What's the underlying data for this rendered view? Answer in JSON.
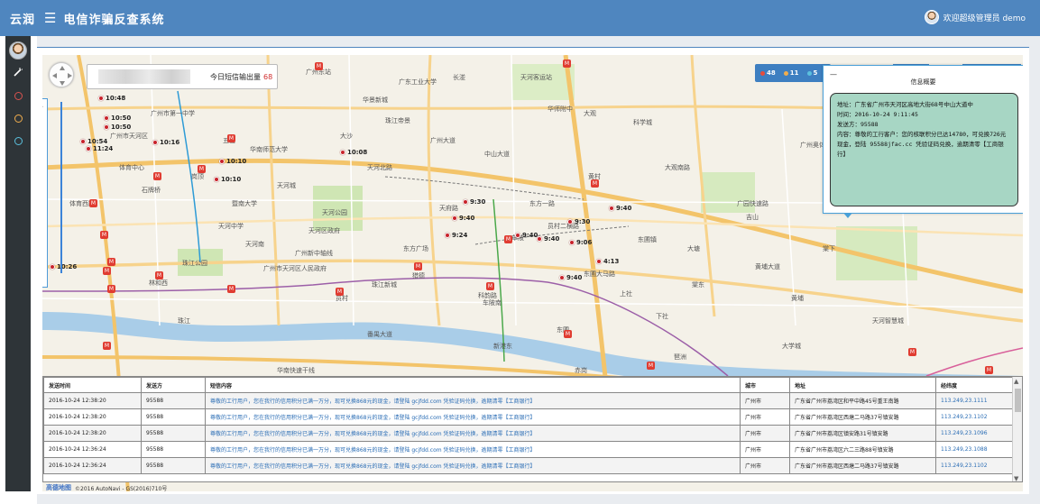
{
  "header": {
    "brand": "云润",
    "menu_icon": "☰",
    "title": "电信诈骗反查系统",
    "welcome": "欢迎超级管理员 demo"
  },
  "sidenav": {
    "items": [
      {
        "name": "wand-icon",
        "glyph": "✎",
        "color": "#ffffff"
      },
      {
        "name": "red-circle-icon",
        "color": "#d9534f"
      },
      {
        "name": "orange-circle-icon",
        "color": "#f0ad4e"
      },
      {
        "name": "blue-circle-icon",
        "color": "#5bc0de"
      }
    ]
  },
  "count_box": {
    "label": "今日短信输出量",
    "value": "68"
  },
  "stats": {
    "red": "48",
    "orange": "11",
    "blue": "5"
  },
  "popup": {
    "close": "—",
    "title": "信息概要",
    "address": "地址：广东省广州市天河区高地大街68号中山大道中",
    "time": "时间：2016-10-24 9:11:45",
    "sender": "发送方：95588",
    "content": "内容：尊敬的工行客户：您的核联积分已达14780，可兑换726元现金，登陆 95588jfac.cc 凭验证码兑换，逾期清零【工商银行】"
  },
  "map_labels": [
    "广州东站",
    "广州市天河区",
    "天河公园",
    "天河客运站",
    "黄埔区",
    "珠江公园",
    "暨南大学",
    "华南师范大学",
    "体育中心",
    "石牌桥",
    "岗顶",
    "华景新城",
    "五山",
    "车陂",
    "东圃",
    "珠江新城",
    "猎德",
    "员村",
    "科韵路",
    "大观南路",
    "天河南",
    "林和西",
    "体育西路",
    "黄村",
    "棠下",
    "龙洞",
    "东圃大马路",
    "车陂南",
    "员村二横路",
    "广州大道",
    "中山大道",
    "广园快速路",
    "华南快速干线",
    "天河北路",
    "天府路",
    "黄埔大道",
    "珠江",
    "广州新中轴线",
    "琶洲",
    "赤岗",
    "新港东",
    "大塘",
    "天河智慧城",
    "东方一路",
    "珠江帝景",
    "大学城",
    "番禺大道",
    "科学城",
    "萝岗",
    "广州市第一中学",
    "上社",
    "下社",
    "天河区政府",
    "华师附中",
    "广东工业大学",
    "广州奥体中心",
    "东方广场",
    "棠东",
    "广州市天河区人民政府",
    "大观",
    "吉山",
    "黄埔",
    "长湴",
    "大沙",
    "夏园",
    "天河城",
    "天河中学",
    "东圃镇"
  ],
  "markers": [
    {
      "label": "10:48",
      "name": "marker-1048"
    },
    {
      "label": "10:50",
      "name": "marker-1050-a"
    },
    {
      "label": "10:50",
      "name": "marker-1050-b"
    },
    {
      "label": "10:54",
      "name": "marker-1054"
    },
    {
      "label": "11:24",
      "name": "marker-1124"
    },
    {
      "label": "10:16",
      "name": "marker-1016"
    },
    {
      "label": "10:08",
      "name": "marker-1008"
    },
    {
      "label": "10:10",
      "name": "marker-1010-a"
    },
    {
      "label": "10:10",
      "name": "marker-1010-b"
    },
    {
      "label": "10:26",
      "name": "marker-1026"
    },
    {
      "label": "9:30",
      "name": "marker-930-a"
    },
    {
      "label": "9:40",
      "name": "marker-940-a"
    },
    {
      "label": "9:24",
      "name": "marker-924"
    },
    {
      "label": "9:40",
      "name": "marker-940-b"
    },
    {
      "label": "9:30",
      "name": "marker-930-b"
    },
    {
      "label": "9:06",
      "name": "marker-906"
    },
    {
      "label": "9:40",
      "name": "marker-940-c"
    },
    {
      "label": "9:40",
      "name": "marker-940-d"
    },
    {
      "label": "4:13",
      "name": "marker-413"
    },
    {
      "label": "9:40",
      "name": "marker-940-e"
    }
  ],
  "table": {
    "headers": [
      "发送时间",
      "发送方",
      "短信内容",
      "城市",
      "地址",
      "经纬度"
    ],
    "rows": [
      [
        "2016-10-24 12:38:20",
        "95588",
        "尊敬的工行用户，您在我行的信用积分已满一万分，现可兑换868元的现金，请登陆 gcjfdd.com 凭验证码兑换，逾期清零【工商银行】",
        "广州市",
        "广东省广州市荔湾区和平中路45号重王南路",
        "113.249,23.1111"
      ],
      [
        "2016-10-24 12:38:20",
        "95588",
        "尊敬的工行用户，您在我行的信用积分已满一万分，现可兑换868元的现金，请登陆 gcjfdd.com 凭验证码兑换，逾期清零【工商银行】",
        "广州市",
        "广东省广州市荔湾区西塘二马路37号镇安路",
        "113.249,23.1102"
      ],
      [
        "2016-10-24 12:38:20",
        "95588",
        "尊敬的工行用户，您在我行的信用积分已满一万分，现可兑换868元的现金，请登陆 gcjfdd.com 凭验证码兑换，逾期清零【工商银行】",
        "广州市",
        "广东省广州市荔湾区镇安路31号镇安路",
        "113.249,23.1096"
      ],
      [
        "2016-10-24 12:36:24",
        "95588",
        "尊敬的工行用户，您在我行的信用积分已满一万分，现可兑换868元的现金，请登陆 gcjfdd.com 凭验证码兑换，逾期清零【工商银行】",
        "广州市",
        "广东省广州市荔湾区六二三路88号镇安路",
        "113.249,23.1088"
      ],
      [
        "2016-10-24 12:36:24",
        "95588",
        "尊敬的工行用户，您在我行的信用积分已满一万分，现可兑换868元的现金，请登陆 gcjfdd.com 凭验证码兑换，逾期清零【工商银行】",
        "广州市",
        "广东省广州市荔湾区西塘二马路37号镇安路",
        "113.249,23.1102"
      ]
    ]
  },
  "attribution": {
    "logo": "高德地图",
    "text": "©2016 AutoNavi - GS(2016)710号"
  },
  "colors": {
    "header": "#4f86bf",
    "marker": "#c8222a",
    "popup_body": "#a7d6c4",
    "link": "#2a6db5"
  }
}
